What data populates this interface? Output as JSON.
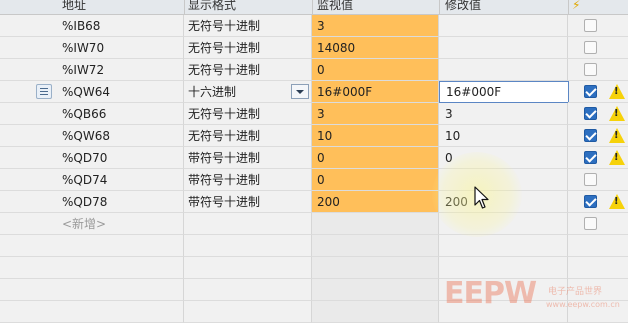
{
  "header": {
    "address": "地址",
    "format": "显示格式",
    "monitor": "监视值",
    "modify": "修改值",
    "modify_column_icon": "lightning-icon"
  },
  "rows": [
    {
      "address": "%IB68",
      "format": "无符号十进制",
      "monitor": "3",
      "modify": "",
      "checked": false,
      "warning": false
    },
    {
      "address": "%IW70",
      "format": "无符号十进制",
      "monitor": "14080",
      "modify": "",
      "checked": false,
      "warning": false
    },
    {
      "address": "%IW72",
      "format": "无符号十进制",
      "monitor": "0",
      "modify": "",
      "checked": false,
      "warning": false
    },
    {
      "address": "%QW64",
      "format": "十六进制",
      "monitor": "16#000F",
      "modify": "16#000F",
      "checked": true,
      "warning": true
    },
    {
      "address": "%QB66",
      "format": "无符号十进制",
      "monitor": "3",
      "modify": "3",
      "checked": true,
      "warning": true
    },
    {
      "address": "%QW68",
      "format": "无符号十进制",
      "monitor": "10",
      "modify": "10",
      "checked": true,
      "warning": true
    },
    {
      "address": "%QD70",
      "format": "带符号十进制",
      "monitor": "0",
      "modify": "0",
      "checked": true,
      "warning": true
    },
    {
      "address": "%QD74",
      "format": "带符号十进制",
      "monitor": "0",
      "modify": "",
      "checked": false,
      "warning": false
    },
    {
      "address": "%QD78",
      "format": "带符号十进制",
      "monitor": "200",
      "modify": "200",
      "checked": true,
      "warning": true
    }
  ],
  "new_row": {
    "address": "<新增>"
  },
  "selected_row_index": 3,
  "watermark": {
    "logo": "EEPW",
    "sub": "电子产品世界",
    "url": "www.eepw.com.cn"
  },
  "colors": {
    "monitor_bg": "#ffbf5a",
    "checkbox_on": "#2d6fc0",
    "warning": "#f6d20a"
  }
}
